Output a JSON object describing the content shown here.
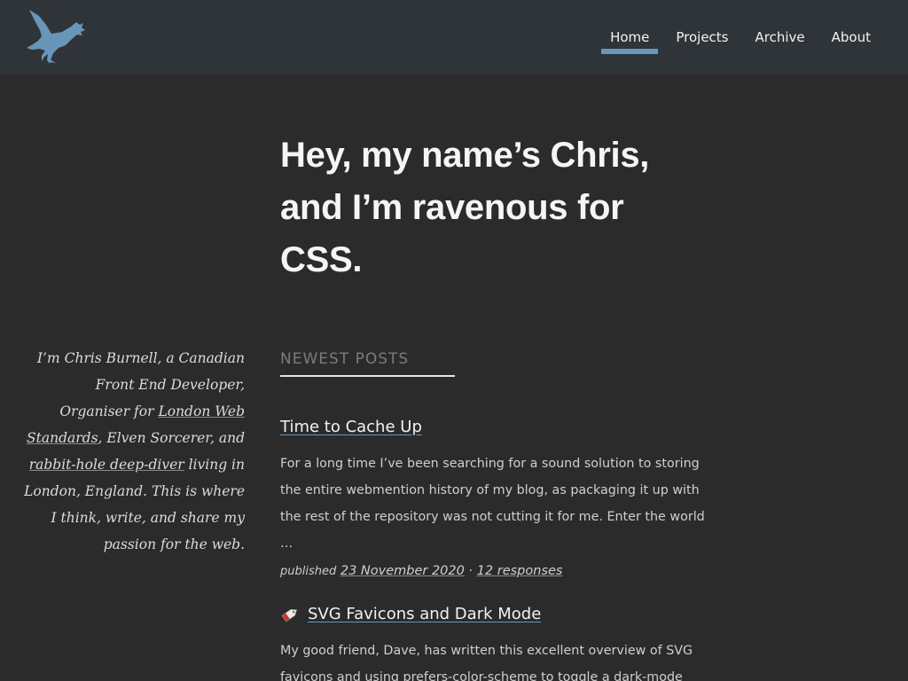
{
  "nav": {
    "items": [
      {
        "label": "Home",
        "active": true
      },
      {
        "label": "Projects",
        "active": false
      },
      {
        "label": "Archive",
        "active": false
      },
      {
        "label": "About",
        "active": false
      }
    ]
  },
  "logo": {
    "icon": "raven-icon",
    "color": "#6896b9"
  },
  "hero": {
    "title": "Hey, my name’s Chris, and I’m ravenous for CSS."
  },
  "bio": {
    "text_1": "I’m Chris Burnell, a Canadian Front End Developer, Organiser for ",
    "link_1": "London Web Standards",
    "text_2": ", Elven Sorcerer, and ",
    "link_2": "rabbit-hole deep-diver",
    "text_3": " living in London, England. This is where I think, write, and share my passion for the web."
  },
  "section": {
    "heading": "NEWEST POSTS"
  },
  "posts": [
    {
      "title": "Time to Cache Up",
      "excerpt": "For a long time I’ve been searching for a sound solution to storing the entire webmention history of my blog, as packaging it up with the rest of the repository was not cutting it for me. Enter the world …",
      "published_label": "published",
      "date": "23 November 2020",
      "separator": "·",
      "responses": "12 responses"
    },
    {
      "icon": "bookmark-tag-icon",
      "title": "SVG Favicons and Dark Mode",
      "excerpt": "My good friend, Dave, has written this excellent overview of SVG favicons and using prefers-color-scheme to toggle a dark-mode"
    }
  ],
  "colors": {
    "header_bg": "#2f3439",
    "page_bg": "#2b2b2c",
    "accent": "#6896b9"
  }
}
